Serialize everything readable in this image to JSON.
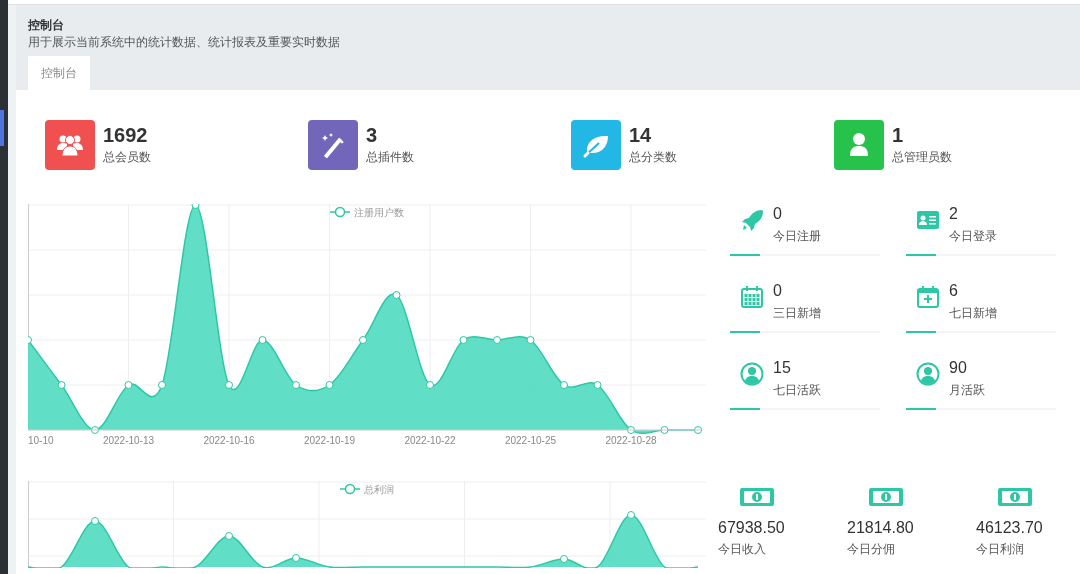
{
  "header": {
    "title": "控制台",
    "subtitle": "用于展示当前系统中的统计数据、统计报表及重要实时数据"
  },
  "tabs": [
    {
      "label": "控制台",
      "selected": true
    }
  ],
  "stats": [
    {
      "kind": "members",
      "value": "1692",
      "label": "总会员数",
      "color": "#f05050"
    },
    {
      "kind": "wand",
      "value": "3",
      "label": "总插件数",
      "color": "#7266ba"
    },
    {
      "kind": "leaf",
      "value": "14",
      "label": "总分类数",
      "color": "#23b7e5"
    },
    {
      "kind": "user",
      "value": "1",
      "label": "总管理员数",
      "color": "#27c24c"
    }
  ],
  "registrations_chart": {
    "legend": "注册用户数",
    "x_labels": [
      "10-10",
      "2022-10-13",
      "2022-10-16",
      "2022-10-19",
      "2022-10-22",
      "2022-10-25",
      "2022-10-28"
    ]
  },
  "activity": [
    {
      "kind": "rocket",
      "value": "0",
      "label": "今日注册"
    },
    {
      "kind": "card",
      "value": "2",
      "label": "今日登录"
    },
    {
      "kind": "calendar",
      "value": "0",
      "label": "三日新增"
    },
    {
      "kind": "calendar-plus",
      "value": "6",
      "label": "七日新增"
    },
    {
      "kind": "user-circle",
      "value": "15",
      "label": "七日活跃"
    },
    {
      "kind": "user-circle",
      "value": "90",
      "label": "月活跃"
    }
  ],
  "profit_chart": {
    "legend": "总利润"
  },
  "money": [
    {
      "value": "67938.50",
      "label": "今日收入"
    },
    {
      "value": "21814.80",
      "label": "今日分佣"
    },
    {
      "value": "46123.70",
      "label": "今日利润"
    }
  ]
}
